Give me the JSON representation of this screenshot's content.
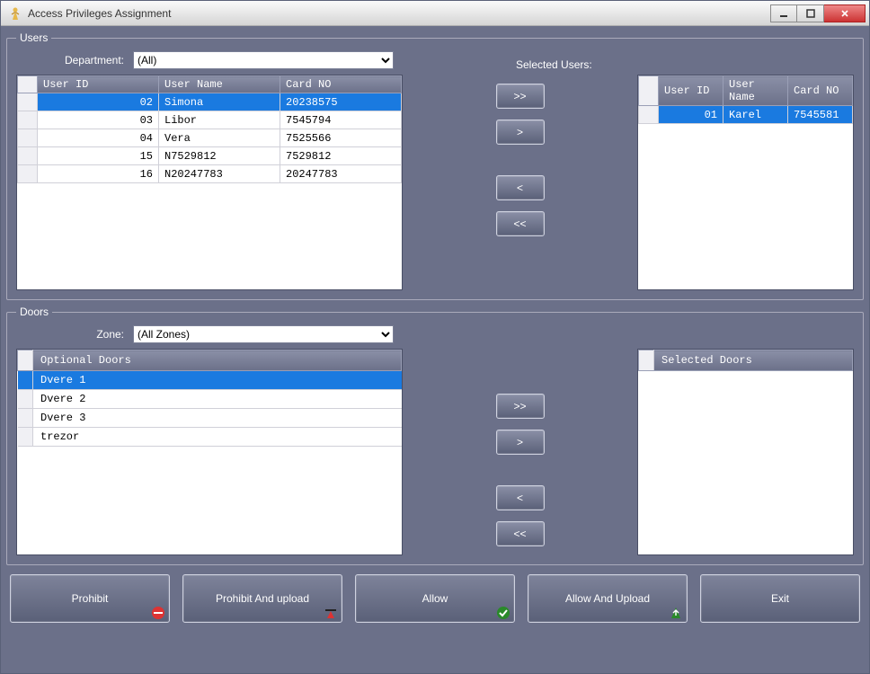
{
  "window": {
    "title": "Access Privileges Assignment"
  },
  "users_panel": {
    "legend": "Users",
    "dept_label": "Department:",
    "dept_value": "(All)",
    "cols": [
      "User ID",
      "User Name",
      "Card NO"
    ],
    "rows": [
      {
        "id": "02",
        "name": "Simona",
        "card": "20238575",
        "selected": true
      },
      {
        "id": "03",
        "name": "Libor",
        "card": "7545794",
        "selected": false
      },
      {
        "id": "04",
        "name": "Vera",
        "card": "7525566",
        "selected": false
      },
      {
        "id": "15",
        "name": "N7529812",
        "card": "7529812",
        "selected": false
      },
      {
        "id": "16",
        "name": "N20247783",
        "card": "20247783",
        "selected": false
      }
    ],
    "selected_label": "Selected Users:",
    "selected_rows": [
      {
        "id": "01",
        "name": "Karel",
        "card": "7545581",
        "selected": true
      }
    ]
  },
  "doors_panel": {
    "legend": "Doors",
    "zone_label": "Zone:",
    "zone_value": "(All Zones)",
    "optional_header": "Optional Doors",
    "optional_rows": [
      {
        "name": "Dvere 1",
        "selected": true
      },
      {
        "name": "Dvere 2",
        "selected": false
      },
      {
        "name": "Dvere 3",
        "selected": false
      },
      {
        "name": "trezor",
        "selected": false
      }
    ],
    "selected_header": "Selected Doors",
    "selected_rows": []
  },
  "xfer": {
    "move_all_right": ">>",
    "move_right": ">",
    "move_left": "<",
    "move_all_left": "<<"
  },
  "buttons": {
    "prohibit": "Prohibit",
    "prohibit_upload": "Prohibit And upload",
    "allow": "Allow",
    "allow_upload": "Allow And Upload",
    "exit": "Exit"
  }
}
